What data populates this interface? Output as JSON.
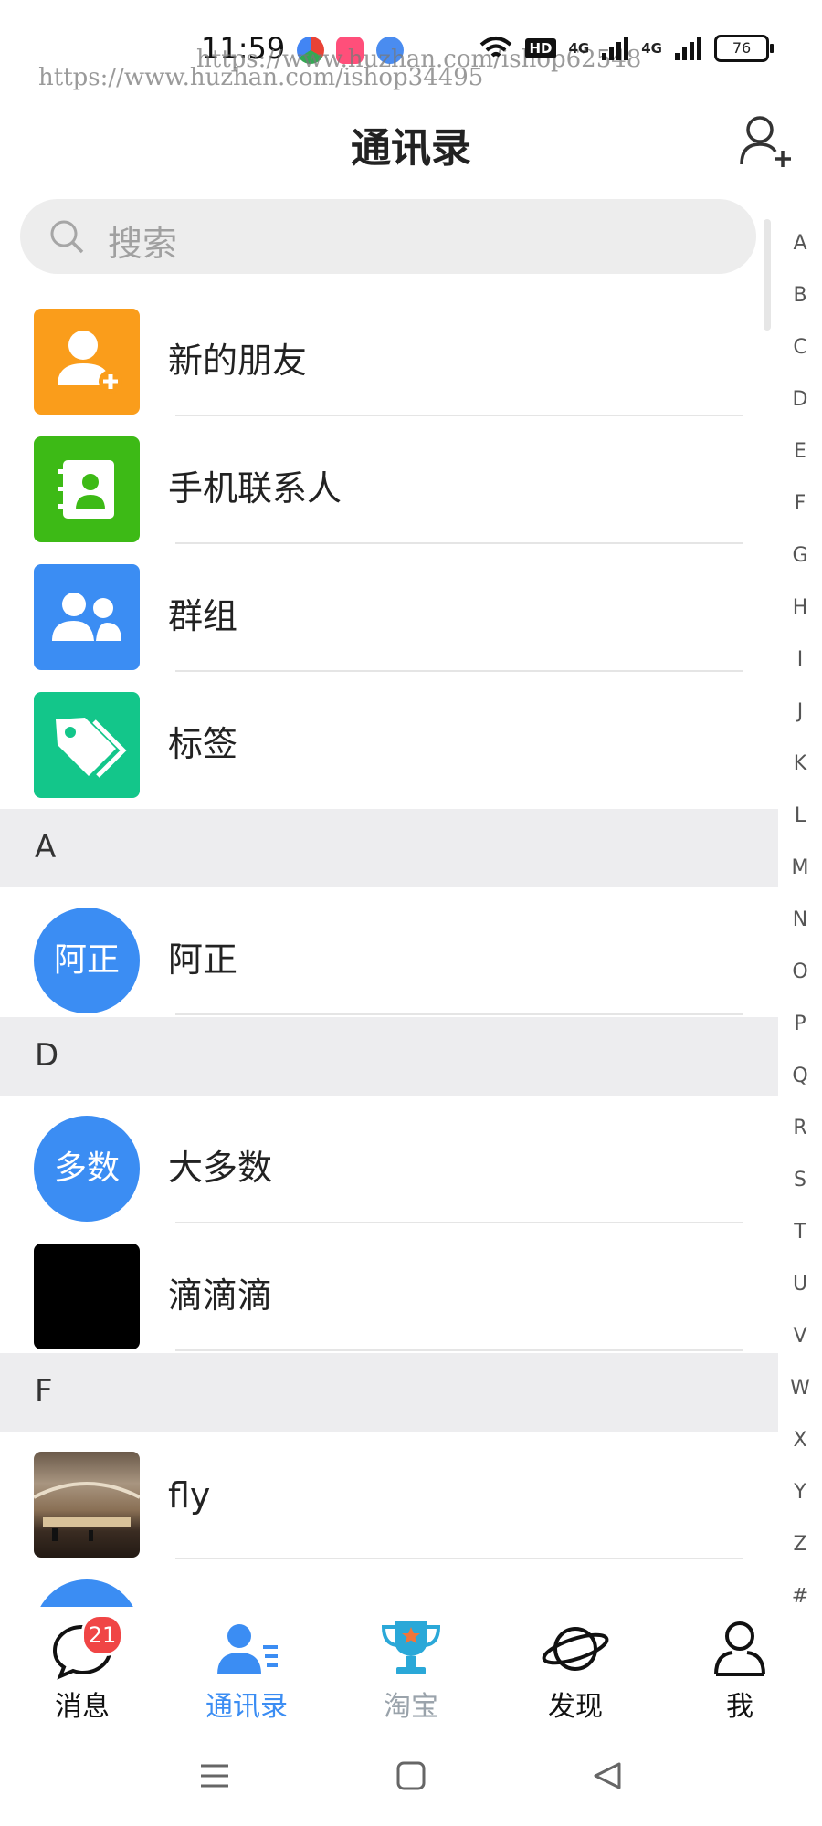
{
  "status_bar": {
    "time": "11:59",
    "battery": "76",
    "network_labels": [
      "4G",
      "4G"
    ],
    "hd_label": "HD",
    "watermarks": [
      "https://www.huzhan.com/ishop62548",
      "https://www.huzhan.com/ishop34495"
    ]
  },
  "header": {
    "title": "通讯录"
  },
  "search": {
    "placeholder": "搜索"
  },
  "features": [
    {
      "label": "新的朋友",
      "icon": "add-user-icon",
      "color": "#fa9d1b"
    },
    {
      "label": "手机联系人",
      "icon": "phone-contacts-icon",
      "color": "#3dba16"
    },
    {
      "label": "群组",
      "icon": "group-icon",
      "color": "#3b8df3"
    },
    {
      "label": "标签",
      "icon": "tag-icon",
      "color": "#13c68a"
    }
  ],
  "sections": [
    {
      "letter": "A",
      "contacts": [
        {
          "name": "阿正",
          "avatar_text": "阿正"
        }
      ]
    },
    {
      "letter": "D",
      "contacts": [
        {
          "name": "大多数",
          "avatar_text": "多数"
        },
        {
          "name": "滴滴滴",
          "avatar_text": ""
        }
      ]
    },
    {
      "letter": "F",
      "contacts": [
        {
          "name": "fly",
          "avatar_text": ""
        }
      ]
    }
  ],
  "index_letters": [
    "A",
    "B",
    "C",
    "D",
    "E",
    "F",
    "G",
    "H",
    "I",
    "J",
    "K",
    "L",
    "M",
    "N",
    "O",
    "P",
    "Q",
    "R",
    "S",
    "T",
    "U",
    "V",
    "W",
    "X",
    "Y",
    "Z",
    "#"
  ],
  "tabs": [
    {
      "label": "消息",
      "icon": "message-icon",
      "badge": "21",
      "active": false
    },
    {
      "label": "通讯录",
      "icon": "contacts-icon",
      "active": true
    },
    {
      "label": "淘宝",
      "icon": "trophy-icon",
      "active": false
    },
    {
      "label": "发现",
      "icon": "planet-icon",
      "active": false
    },
    {
      "label": "我",
      "icon": "profile-icon",
      "active": false
    }
  ],
  "colors": {
    "accent": "#3b8df3",
    "avatar_blue": "#3b8df3",
    "badge": "#f04545",
    "inactive_tab": "#9aa3ab"
  }
}
